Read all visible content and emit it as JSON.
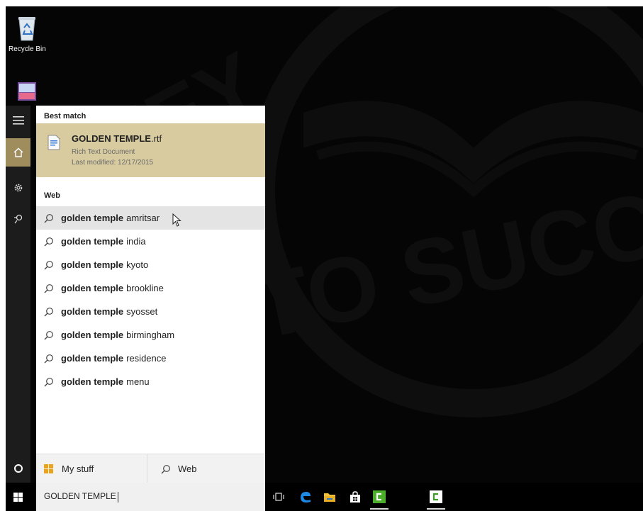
{
  "desktop": {
    "recycle_bin_label": "Recycle Bin"
  },
  "start_menu": {
    "best_match": {
      "heading": "Best match",
      "title_bold": "GOLDEN TEMPLE",
      "title_ext": ".rtf",
      "type": "Rich Text Document",
      "modified": "Last modified: 12/17/2015"
    },
    "web_heading": "Web",
    "suggestions": [
      {
        "bold": "golden temple",
        "rest": "amritsar"
      },
      {
        "bold": "golden temple",
        "rest": "india"
      },
      {
        "bold": "golden temple",
        "rest": "kyoto"
      },
      {
        "bold": "golden temple",
        "rest": "brookline"
      },
      {
        "bold": "golden temple",
        "rest": "syosset"
      },
      {
        "bold": "golden temple",
        "rest": "birmingham"
      },
      {
        "bold": "golden temple",
        "rest": "residence"
      },
      {
        "bold": "golden temple",
        "rest": "menu"
      }
    ],
    "filters": {
      "my_stuff": "My stuff",
      "web": "Web"
    }
  },
  "taskbar": {
    "search_value": "GOLDEN TEMPLE"
  },
  "watermark": {
    "line1": "KEY",
    "line2": "TO SUCC"
  },
  "colors": {
    "best_match_bg": "#d8cba0",
    "rail_active": "#a08d5e",
    "edge_blue": "#1e88e5",
    "camtasia_green": "#4caf2b"
  }
}
